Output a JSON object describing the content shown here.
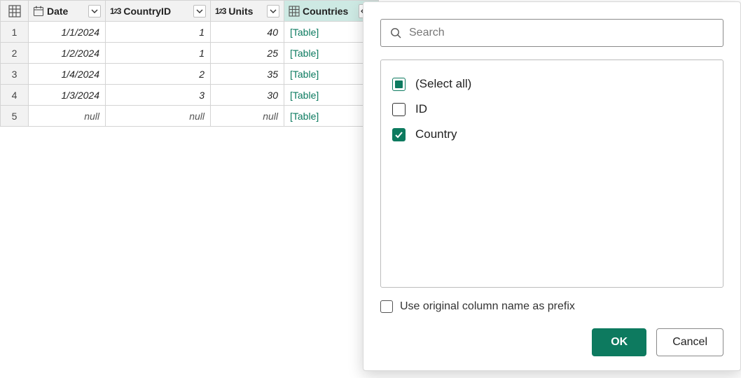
{
  "columns": {
    "date": {
      "label": "Date"
    },
    "cid": {
      "label": "CountryID"
    },
    "units": {
      "label": "Units"
    },
    "countries": {
      "label": "Countries"
    }
  },
  "rows": [
    {
      "n": "1",
      "date": "1/1/2024",
      "cid": "1",
      "units": "40",
      "countries": "[Table]"
    },
    {
      "n": "2",
      "date": "1/2/2024",
      "cid": "1",
      "units": "25",
      "countries": "[Table]"
    },
    {
      "n": "3",
      "date": "1/4/2024",
      "cid": "2",
      "units": "35",
      "countries": "[Table]"
    },
    {
      "n": "4",
      "date": "1/3/2024",
      "cid": "3",
      "units": "30",
      "countries": "[Table]"
    },
    {
      "n": "5",
      "date": "null",
      "cid": "null",
      "units": "null",
      "countries": "[Table]"
    }
  ],
  "popup": {
    "search_placeholder": "Search",
    "options": {
      "select_all": "(Select all)",
      "id": "ID",
      "country": "Country"
    },
    "prefix_label": "Use original column name as prefix",
    "ok": "OK",
    "cancel": "Cancel"
  }
}
